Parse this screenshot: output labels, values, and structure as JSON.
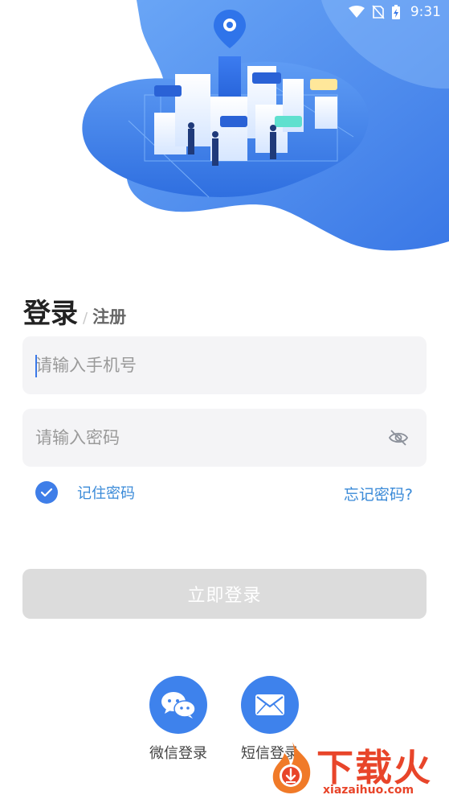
{
  "status_bar": {
    "time": "9:31",
    "icons": [
      "wifi-icon",
      "no-sim-icon",
      "battery-charging-icon"
    ]
  },
  "hero": {
    "illustration": "city-location-illustration",
    "colors": {
      "primary": "#3e82ec",
      "light": "#86b6f8"
    }
  },
  "auth_tabs": {
    "login": "登录",
    "separator": "/",
    "register": "注册"
  },
  "form": {
    "phone_placeholder": "请输入手机号",
    "password_placeholder": "请输入密码",
    "password_toggle_icon": "eye-off-icon",
    "remember_label": "记住密码",
    "remember_checked": true,
    "forgot_label": "忘记密码?",
    "submit_label": "立即登录"
  },
  "social": {
    "wechat_label": "微信登录",
    "sms_label": "短信登录",
    "wechat_icon": "wechat-icon",
    "sms_icon": "mail-icon"
  },
  "watermark": {
    "text": "下载火",
    "url": "xiazaihuo.com",
    "color": "#e8452a"
  },
  "colors": {
    "accent": "#3e82ec",
    "link": "#3a8ad8",
    "button_disabled": "#dcdcdc",
    "field_bg": "#f4f4f6"
  }
}
